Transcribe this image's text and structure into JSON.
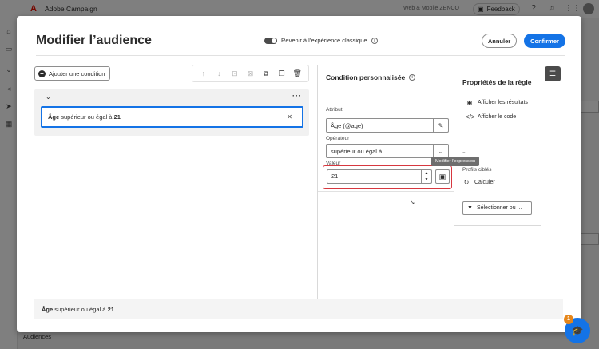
{
  "app": {
    "title": "Adobe Campaign",
    "org": "Web & Mobile ZENCO",
    "feedback_label": "Feedback",
    "nav_audiences": "Audiences"
  },
  "modal": {
    "title": "Modifier l’audience",
    "classic_toggle_label": "Revenir à l’expérience classique",
    "cancel_label": "Annuler",
    "confirm_label": "Confirmer"
  },
  "canvas": {
    "add_condition_label": "Ajouter une condition",
    "condition": {
      "attribute": "Âge",
      "rest": "supérieur ou égal à",
      "value": "21"
    },
    "summary": {
      "attribute": "Âge",
      "rest": "supérieur ou égal à",
      "value": "21"
    }
  },
  "custom_condition": {
    "title": "Condition personnalisée",
    "attribute_label": "Attribut",
    "attribute_value": "Âge (@age)",
    "operator_label": "Opérateur",
    "operator_value": "supérieur ou égal à",
    "value_label": "Valeur",
    "value": "21",
    "tooltip": "Modifier l’expression"
  },
  "rule_properties": {
    "title": "Propriétés de la règle",
    "show_results": "Afficher les résultats",
    "show_code": "Afficher le code",
    "count_placeholder": "-",
    "targeted_profiles_label": "Profils ciblés",
    "calculate_label": "Calculer",
    "select_label": "Sélectionner ou ..."
  },
  "learn_badge_count": "1"
}
